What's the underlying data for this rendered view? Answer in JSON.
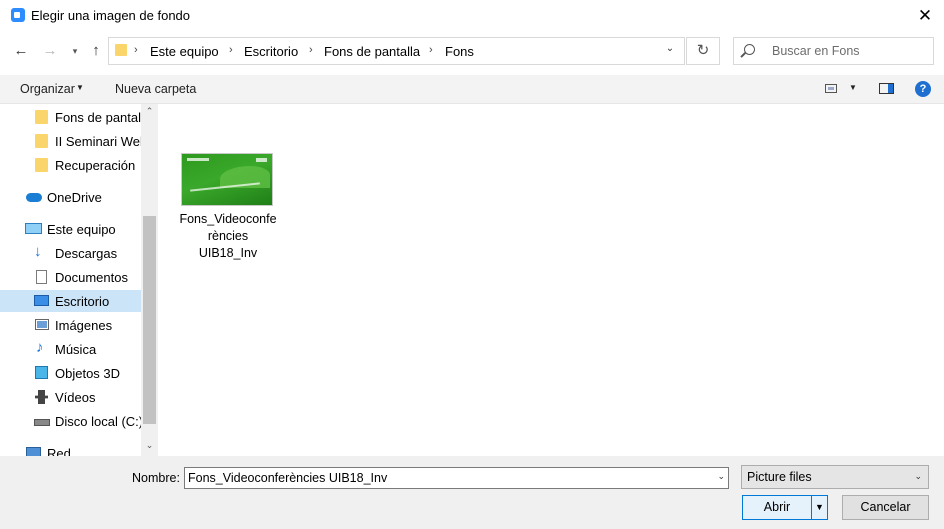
{
  "window": {
    "title": "Elegir una imagen de fondo",
    "close_glyph": "✕"
  },
  "nav": {
    "back_glyph": "←",
    "forward_glyph": "→",
    "recent_glyph": "▾",
    "up_glyph": "↑"
  },
  "address": {
    "crumbs": [
      "Este equipo",
      "Escritorio",
      "Fons de pantalla",
      "Fons"
    ],
    "separator": "›",
    "dropdown_glyph": "⌄"
  },
  "refresh_glyph": "↻",
  "search": {
    "placeholder": "Buscar en Fons",
    "value": ""
  },
  "toolbar": {
    "organize_label": "Organizar",
    "organize_chevron": "▼",
    "new_folder_label": "Nueva carpeta",
    "view_chevron": "▼",
    "help_glyph": "?"
  },
  "sidebar": {
    "items": [
      {
        "label": "Fons de pantalla",
        "icon": "folder-icon"
      },
      {
        "label": "II Seminari Web",
        "icon": "folder-icon"
      },
      {
        "label": "Recuperación",
        "icon": "folder-icon"
      },
      {
        "label": "OneDrive",
        "icon": "onedrive-icon"
      },
      {
        "label": "Este equipo",
        "icon": "computer-icon"
      },
      {
        "label": "Descargas",
        "icon": "downloads-icon"
      },
      {
        "label": "Documentos",
        "icon": "documents-icon"
      },
      {
        "label": "Escritorio",
        "icon": "desktop-icon",
        "selected": true
      },
      {
        "label": "Imágenes",
        "icon": "pictures-icon"
      },
      {
        "label": "Música",
        "icon": "music-icon"
      },
      {
        "label": "Objetos 3D",
        "icon": "objects-3d-icon"
      },
      {
        "label": "Vídeos",
        "icon": "videos-icon"
      },
      {
        "label": "Disco local (C:)",
        "icon": "local-disk-icon"
      },
      {
        "label": "Red",
        "icon": "network-icon"
      }
    ],
    "scroll_up_glyph": "⌃",
    "scroll_down_glyph": "⌄"
  },
  "files": [
    {
      "name": "Fons_Videoconferències UIB18_Inv",
      "icon": "image-thumbnail"
    }
  ],
  "bottom": {
    "name_label": "Nombre:",
    "name_value": "Fons_Videoconferències UIB18_Inv",
    "name_dropdown_glyph": "⌄",
    "filetype_label": "Picture files",
    "filetype_dropdown_glyph": "⌄",
    "open_label": "Abrir",
    "open_dropdown_glyph": "▼",
    "cancel_label": "Cancelar"
  },
  "colors": {
    "accent": "#0078d7",
    "selection": "#cce4f7",
    "folder": "#f9d56c"
  }
}
